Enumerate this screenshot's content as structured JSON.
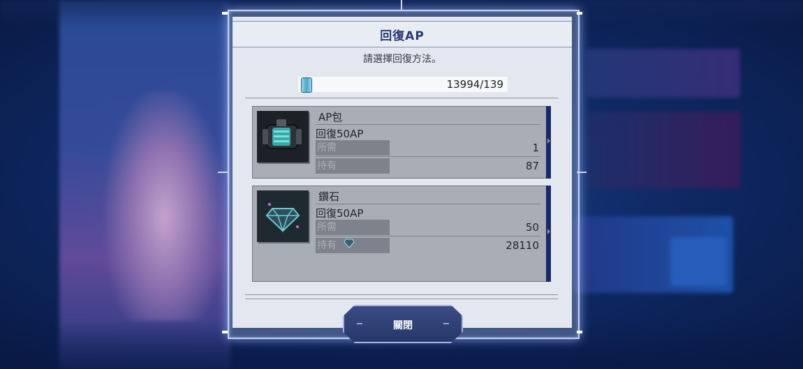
{
  "dialog": {
    "title": "回復AP",
    "subtitle": "請選擇回復方法。",
    "ap_value": "13994/139",
    "ap_icon": "ap-battery-icon"
  },
  "options": [
    {
      "name": "AP包",
      "recover": "回復50AP",
      "required_label": "所需",
      "required_value": "1",
      "owned_label": "持有",
      "owned_value": "87",
      "icon": "ap-pack-icon"
    },
    {
      "name": "鑽石",
      "recover": "回復50AP",
      "required_label": "所需",
      "required_value": "50",
      "owned_label": "持有",
      "owned_value": "28110",
      "icon": "diamond-icon"
    }
  ],
  "close_button": {
    "label": "關閉"
  },
  "colors": {
    "panel": "#e2e7f0",
    "title": "#2a3a72",
    "card": "#a9adb5",
    "accent": "#1a2866",
    "button": "#2f4178"
  }
}
